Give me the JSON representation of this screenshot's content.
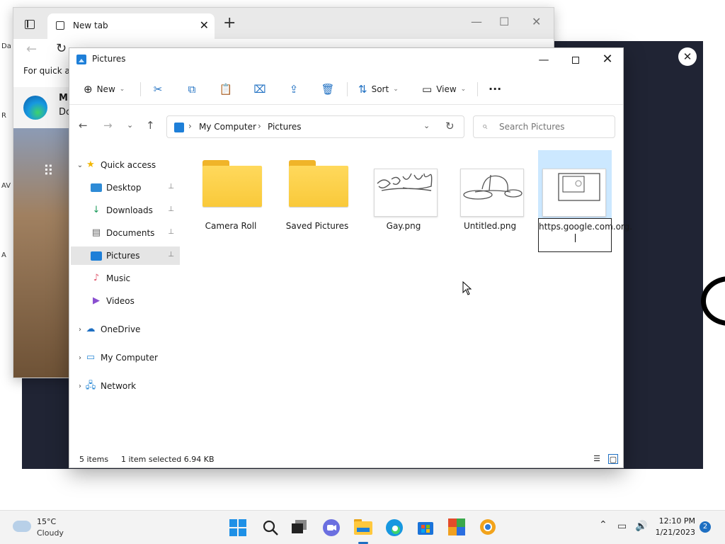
{
  "browser": {
    "tab_title": "New tab",
    "tab_close": "✕",
    "new_tab": "+",
    "minimize": "—",
    "maximize": "☐",
    "close": "✕",
    "back": "←",
    "reload": "↻",
    "favorites_text": "For quick ac",
    "edge_title": "Mi",
    "edge_sub": "Do",
    "apps_grid": "⠿"
  },
  "desktop": {
    "labels": [
      "Da",
      "R",
      "AV",
      "A"
    ],
    "dark_close": "✕"
  },
  "explorer": {
    "title": "Pictures",
    "minimize": "—",
    "close": "✕",
    "commands": {
      "new_label": "New",
      "sort_label": "Sort",
      "view_label": "View",
      "more": "···",
      "chevron": "⌄"
    },
    "nav": {
      "back": "←",
      "forward": "→",
      "recent": "⌄",
      "up": "↑"
    },
    "address": {
      "crumbs": [
        "My Computer",
        "Pictures"
      ],
      "separator": "›",
      "dropdown": "⌄",
      "refresh": "↻"
    },
    "search": {
      "placeholder": "Search Pictures"
    },
    "sidebar": {
      "items": [
        {
          "label": "Quick access",
          "expander": "⌄"
        },
        {
          "label": "Desktop",
          "pin": "📌"
        },
        {
          "label": "Downloads",
          "pin": "📌"
        },
        {
          "label": "Documents",
          "pin": "📌"
        },
        {
          "label": "Pictures",
          "pin": "📌"
        },
        {
          "label": "Music"
        },
        {
          "label": "Videos"
        },
        {
          "label": "OneDrive",
          "expander": "›"
        },
        {
          "label": "My Computer",
          "expander": "›"
        },
        {
          "label": "Network",
          "expander": "›"
        }
      ]
    },
    "files": [
      {
        "name": "Camera Roll",
        "type": "folder"
      },
      {
        "name": "Saved Pictures",
        "type": "folder"
      },
      {
        "name": "Gay.png",
        "type": "image"
      },
      {
        "name": "Untitled.png",
        "type": "image"
      },
      {
        "name": "https.google.com.org.",
        "type": "image",
        "selected": true,
        "renaming": true
      }
    ],
    "status": {
      "count": "5 items",
      "selection": "1 item selected  6.94 KB"
    }
  },
  "taskbar": {
    "temperature": "15°C",
    "condition": "Cloudy",
    "time": "12:10 PM",
    "date": "1/21/2023",
    "notification_count": "2",
    "tray_chevron": "⌃"
  },
  "colors": {
    "accent": "#1e6fc2",
    "selection": "#cce8ff",
    "folder": "#f9c93a",
    "dark_background": "#202434"
  }
}
